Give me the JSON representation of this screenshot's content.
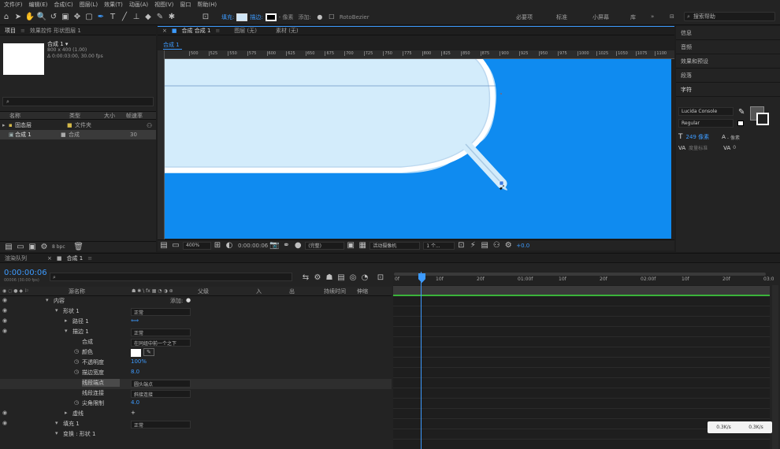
{
  "menu": [
    "文件(F)",
    "编辑(E)",
    "合成(C)",
    "图层(L)",
    "效果(T)",
    "动画(A)",
    "视图(V)",
    "窗口",
    "帮助(H)"
  ],
  "toolbar": {
    "fill_label": "填充:",
    "stroke_label": "描边:",
    "stroke_width": "- 像素",
    "add_label": "添加:",
    "rotobezier_label": "RotoBezier",
    "workspaces": [
      "必要项",
      "标准",
      "小屏幕",
      "库"
    ],
    "search_placeholder": "搜索帮助"
  },
  "project": {
    "tabs": [
      "项目",
      "效果控件 形状图层 1"
    ],
    "comp_name": "合成 1 ▾",
    "comp_info_1": "800 x 400 (1.00)",
    "comp_info_2": "Δ 0:00:03:00, 30.00 fps",
    "columns": [
      "名称",
      "类型",
      "大小",
      "帧速率"
    ],
    "items": [
      {
        "name": "固态层",
        "type": "文件夹",
        "size": "",
        "fps": ""
      },
      {
        "name": "合成 1",
        "type": "合成",
        "size": "",
        "fps": "30"
      }
    ],
    "bpc": "8 bpc"
  },
  "viewer": {
    "tabs": [
      "合成 合成 1",
      "图层 (无)",
      "素材 (无)"
    ],
    "comp_tab": "合成 1",
    "ruler_ticks": [
      "500",
      "525",
      "550",
      "575",
      "600",
      "625",
      "650",
      "675",
      "700",
      "725",
      "750",
      "775",
      "800",
      "825",
      "850",
      "875",
      "900",
      "925",
      "950",
      "975",
      "1000",
      "1025",
      "1050",
      "1075",
      "1100"
    ],
    "zoom": "400%",
    "timecode": "0:00:00:06",
    "resolution": "(完整)",
    "camera": "活动摄像机",
    "views": "1 个...",
    "exposure": "+0.0"
  },
  "right_panel": {
    "headers": [
      "信息",
      "音频",
      "效果和预设",
      "段落",
      "字符"
    ],
    "font": "Lucida Console",
    "style": "Regular",
    "size_value": "249 像素",
    "leading_value": "- 像素",
    "kerning_value": "度量标准",
    "tracking_value": "0"
  },
  "timeline": {
    "tabs": [
      "渲染队列",
      "合成 1"
    ],
    "timecode": "0:00:00:06",
    "timecode_sub": "00006 (30.00 fps)",
    "columns": [
      "源名称",
      "父级",
      "入",
      "出",
      "持续时间",
      "伸缩"
    ],
    "ruler": [
      "0f",
      "10f",
      "20f",
      "01:00f",
      "10f",
      "20f",
      "02:00f",
      "10f",
      "20f",
      "03:0"
    ],
    "rows": [
      {
        "indent": 1,
        "label": "内容",
        "value": "",
        "extra": "添加:"
      },
      {
        "indent": 2,
        "label": "形状 1",
        "value": "正常",
        "extra": ""
      },
      {
        "indent": 3,
        "label": "路径 1",
        "value": "",
        "extra": ""
      },
      {
        "indent": 3,
        "label": "描边 1",
        "value": "正常",
        "extra": ""
      },
      {
        "indent": 4,
        "label": "合成",
        "value": "在同组中前一个之下",
        "extra": ""
      },
      {
        "indent": 4,
        "label": "颜色",
        "value": "",
        "extra": ""
      },
      {
        "indent": 4,
        "label": "不透明度",
        "value": "100%",
        "extra": ""
      },
      {
        "indent": 4,
        "label": "描边宽度",
        "value": "8.0",
        "extra": ""
      },
      {
        "indent": 4,
        "label": "线段端点",
        "value": "圆头端点",
        "extra": ""
      },
      {
        "indent": 4,
        "label": "线段连接",
        "value": "斜接连接",
        "extra": ""
      },
      {
        "indent": 4,
        "label": "尖角限制",
        "value": "4.0",
        "extra": ""
      },
      {
        "indent": 3,
        "label": "虚线",
        "value": "+",
        "extra": ""
      },
      {
        "indent": 2,
        "label": "填充 1",
        "value": "正常",
        "extra": ""
      },
      {
        "indent": 2,
        "label": "变换 : 形状 1",
        "value": "",
        "extra": ""
      }
    ],
    "speed_down": "0.3K/s",
    "speed_up": "0.3K/s"
  },
  "colors": {
    "canvas_blue": "#0f8bf0",
    "bubble_fill": "#d3ecfb",
    "accent": "#3d9bff"
  }
}
